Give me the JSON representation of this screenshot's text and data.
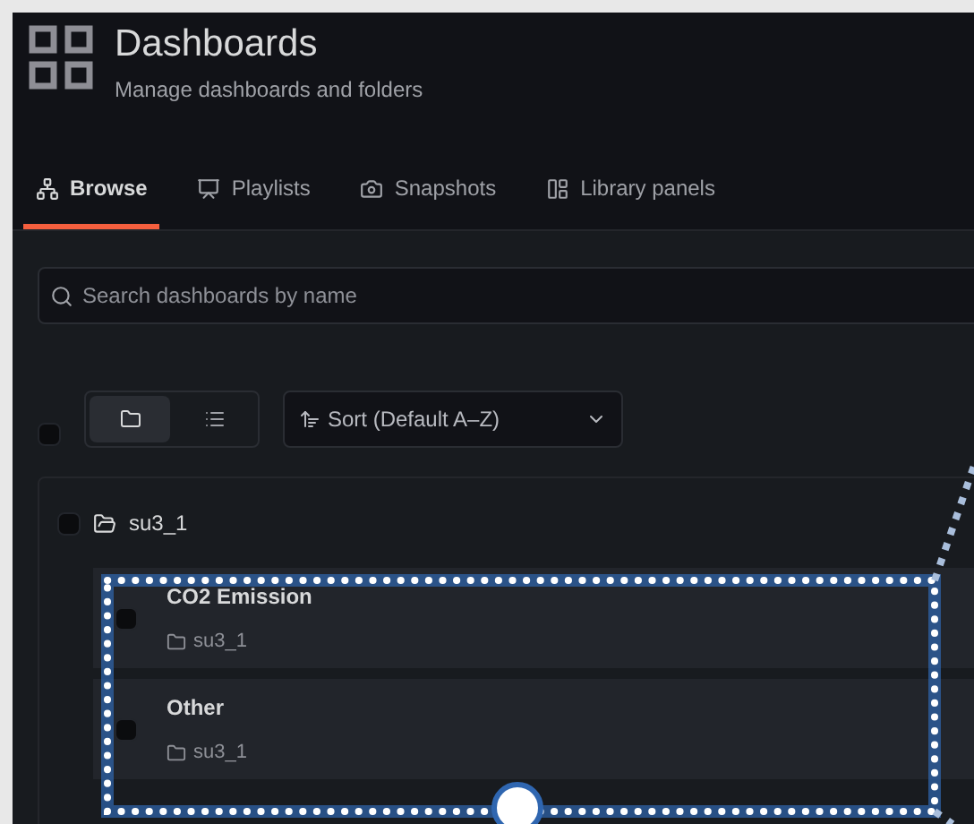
{
  "header": {
    "title": "Dashboards",
    "subtitle": "Manage dashboards and folders"
  },
  "tabs": [
    {
      "label": "Browse",
      "kind": "browse",
      "selected": true
    },
    {
      "label": "Playlists",
      "kind": "playlists",
      "selected": false
    },
    {
      "label": "Snapshots",
      "kind": "snapshots",
      "selected": false
    },
    {
      "label": "Library panels",
      "kind": "library",
      "selected": false
    }
  ],
  "search": {
    "placeholder": "Search dashboards by name"
  },
  "toolbar": {
    "select_all_checked": false,
    "views": [
      {
        "kind": "folders",
        "selected": true
      },
      {
        "kind": "list",
        "selected": false
      }
    ],
    "sort": "Sort (Default A–Z)"
  },
  "folder": {
    "name": "su3_1",
    "checked": false,
    "dashboards": [
      {
        "title": "CO2 Emission",
        "folder": "su3_1",
        "checked": false
      },
      {
        "title": "Other",
        "folder": "su3_1",
        "checked": false
      }
    ]
  }
}
